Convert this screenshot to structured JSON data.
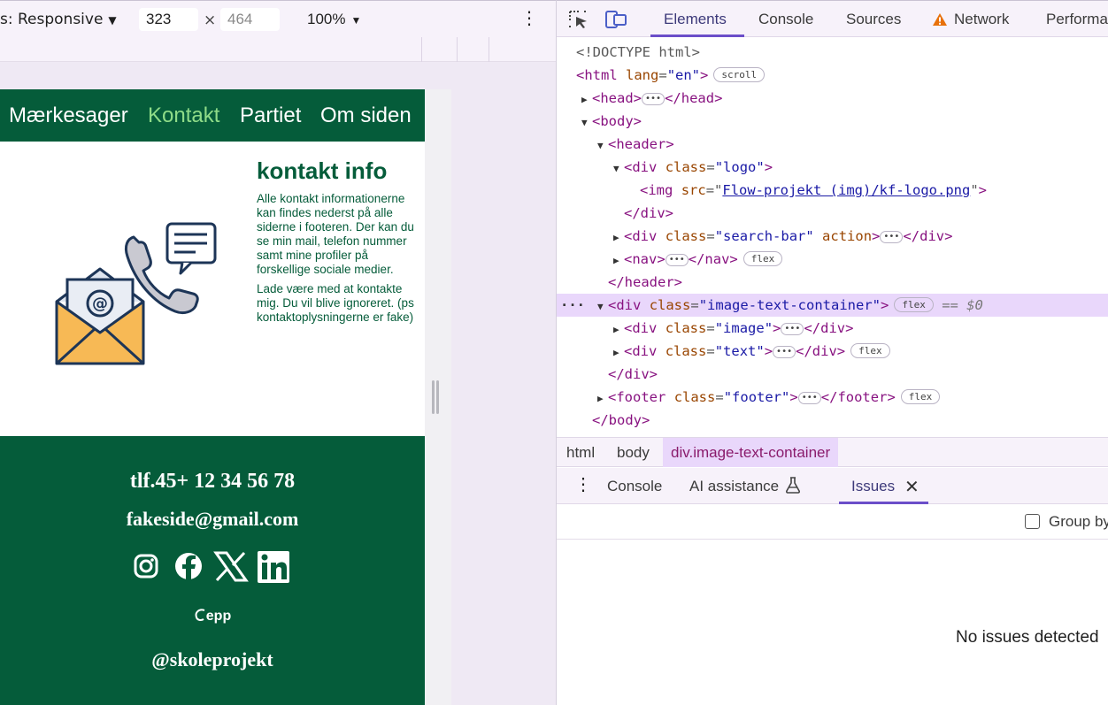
{
  "device_toolbar": {
    "device_label": "s: Responsive",
    "width_value": "323",
    "height_placeholder": "464",
    "times": "×",
    "zoom": "100%",
    "more": "⋮"
  },
  "site": {
    "nav": [
      "Mærkesager",
      "Kontakt",
      "Partiet",
      "Om siden"
    ],
    "active_nav": "Kontakt",
    "title": "kontakt info",
    "paragraph_1": "Alle kontakt informationerne\nkan findes nederst på alle\nsiderne i footeren. Der kan du\nse min mail, telefon nummer\nsamt mine profiler på\nforskellige sociale medier.",
    "paragraph_2": "Lade være med at kontakte\nmig. Du vil blive ignoreret. (ps\nkontaktoplysningerne er fake)",
    "footer": {
      "phone": "tlf.45+ 12 34 56 78",
      "email": "fakeside@gmail.com",
      "social_icons": [
        "instagram-icon",
        "facebook-icon",
        "x-icon",
        "linkedin-icon"
      ],
      "brand": "epp",
      "handle": "@skoleprojekt"
    },
    "colors": {
      "brand_green": "#055c3a",
      "active_link": "#8fdc88"
    }
  },
  "devtools": {
    "tabs": [
      "Elements",
      "Console",
      "Sources",
      "Network",
      "Performa"
    ],
    "active_tab": "Elements",
    "dom": {
      "doctype": "<!DOCTYPE html>",
      "html_open": "<html",
      "html_lang_attr": "lang",
      "html_lang_val": "\"en\"",
      "scroll_badge": "scroll",
      "head": "head",
      "body": "body",
      "header": "header",
      "div": "div",
      "class_attr": "class",
      "logo_val": "\"logo\"",
      "img": "img",
      "src_attr": "src",
      "src_val": "Flow-projekt (img)/kf-logo.png",
      "search_val": "\"search-bar\"",
      "action_attr": "action",
      "nav": "nav",
      "flex_badge": "flex",
      "container_val": "\"image-text-container\"",
      "selected_marker": "== $0",
      "image_val": "\"image\"",
      "text_val": "\"text\"",
      "footer": "footer",
      "footer_val": "\"footer\"",
      "row_dots": "···"
    },
    "breadcrumbs": [
      "html",
      "body",
      "div.image-text-container"
    ],
    "drawer": {
      "tabs": [
        "Console",
        "AI assistance",
        "Issues"
      ],
      "active_tab": "Issues",
      "group_label": "Group by",
      "empty_message": "No issues detected"
    }
  }
}
